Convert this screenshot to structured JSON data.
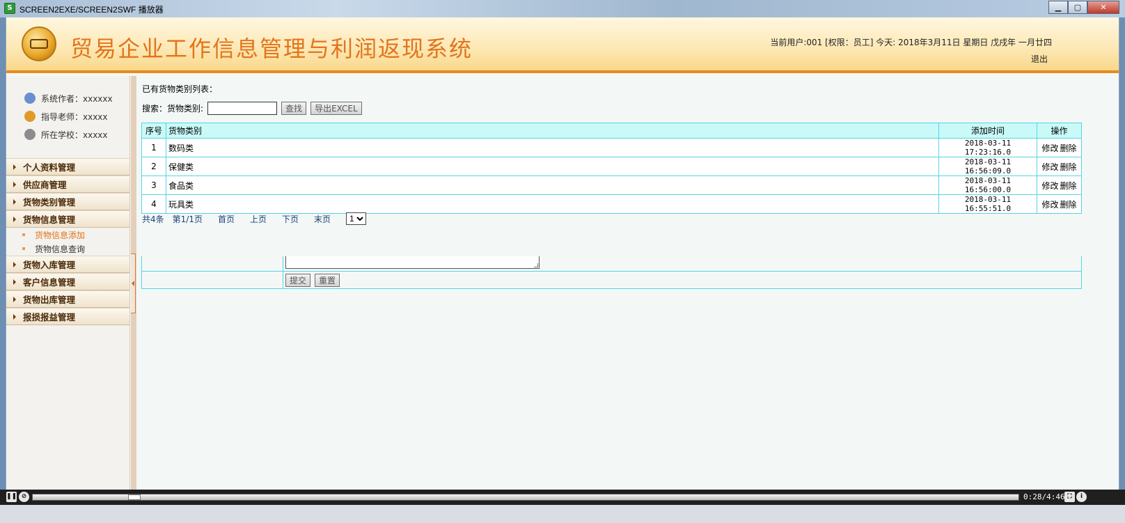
{
  "window": {
    "title": "SCREEN2EXE/SCREEN2SWF 播放器",
    "buttons": {
      "minimize": "▁",
      "maximize": "▢",
      "close": "✕"
    }
  },
  "header": {
    "app_title": "贸易企业工作信息管理与利润返现系统",
    "user_info": "当前用户:001 [权限：员工] 今天:  2018年3月11日 星期日 戊戌年 一月廿四",
    "logout": "退出"
  },
  "sidebar": {
    "info": [
      {
        "label": "系统作者：xxxxxx",
        "icon": "users-icon",
        "color": "#6a8fd0"
      },
      {
        "label": "指导老师：xxxxx",
        "icon": "phone-icon",
        "color": "#e19a2a"
      },
      {
        "label": "所在学校：xxxxx",
        "icon": "clock-icon",
        "color": "#8c8c8c"
      }
    ],
    "menu": [
      {
        "label": "个人资料管理"
      },
      {
        "label": "供应商管理"
      },
      {
        "label": "货物类别管理"
      },
      {
        "label": "货物信息管理"
      },
      {
        "label": "货物入库管理"
      },
      {
        "label": "客户信息管理"
      },
      {
        "label": "货物出库管理"
      },
      {
        "label": "报损报益管理"
      }
    ],
    "submenu": [
      {
        "label": "货物信息添加"
      },
      {
        "label": "货物信息查询"
      }
    ]
  },
  "main": {
    "list_title": "已有货物类别列表：",
    "search": {
      "label": "搜索：货物类别:",
      "value": "",
      "search_button": "查找",
      "export_button": "导出EXCEL"
    },
    "table": {
      "headers": {
        "no": "序号",
        "category": "货物类别",
        "time": "添加时间",
        "op": "操作"
      },
      "rows": [
        {
          "no": "1",
          "category": "数码类",
          "time": "2018-03-11 17:23:16.0",
          "edit": "修改",
          "delete": "删除"
        },
        {
          "no": "2",
          "category": "保健类",
          "time": "2018-03-11 16:56:09.0",
          "edit": "修改",
          "delete": "删除"
        },
        {
          "no": "3",
          "category": "食品类",
          "time": "2018-03-11 16:56:00.0",
          "edit": "修改",
          "delete": "删除"
        },
        {
          "no": "4",
          "category": "玩具类",
          "time": "2018-03-11 16:55:51.0",
          "edit": "修改",
          "delete": "删除"
        }
      ]
    },
    "pager": {
      "total": "共4条",
      "page": "第1/1页",
      "first": "首页",
      "prev": "上页",
      "next": "下页",
      "last": "末页",
      "selected": "1"
    },
    "form": {
      "submit": "提交",
      "reset": "重置"
    }
  },
  "player": {
    "time": "0:28/4:46",
    "progress": 0.098
  }
}
